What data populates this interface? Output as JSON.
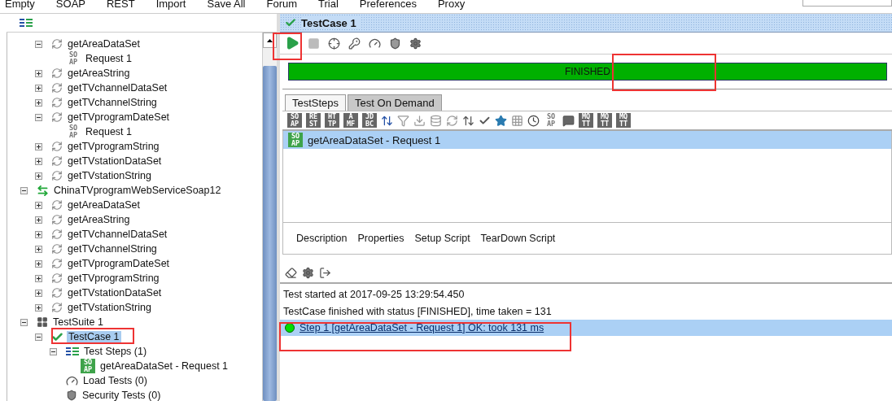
{
  "menu": [
    "Empty",
    "SOAP",
    "REST",
    "Import",
    "Save All",
    "Forum",
    "Trial",
    "Preferences",
    "Proxy"
  ],
  "tree": [
    {
      "kind": "continued",
      "children": [
        {
          "kind": "operation",
          "label": "getAreaDataSet",
          "expanded": true,
          "selected": false,
          "children": [
            {
              "kind": "request",
              "badge": "SO AP",
              "label": "Request 1",
              "selected": false
            }
          ]
        },
        {
          "kind": "operation",
          "label": "getAreaString",
          "expanded": false,
          "selected": false
        },
        {
          "kind": "operation",
          "label": "getTVchannelDataSet",
          "expanded": false,
          "selected": false
        },
        {
          "kind": "operation",
          "label": "getTVchannelString",
          "expanded": false,
          "selected": false
        },
        {
          "kind": "operation",
          "label": "getTVprogramDateSet",
          "expanded": true,
          "selected": false,
          "children": [
            {
              "kind": "request",
              "badge": "SO AP",
              "label": "Request 1",
              "selected": false
            }
          ]
        },
        {
          "kind": "operation",
          "label": "getTVprogramString",
          "expanded": false,
          "selected": false
        },
        {
          "kind": "operation",
          "label": "getTVstationDataSet",
          "expanded": false,
          "selected": false
        },
        {
          "kind": "operation",
          "label": "getTVstationString",
          "expanded": false,
          "selected": false
        }
      ]
    },
    {
      "kind": "service",
      "label": "ChinaTVprogramWebServiceSoap12",
      "expanded": true,
      "selected": false,
      "children": [
        {
          "kind": "operation",
          "label": "getAreaDataSet",
          "expanded": false,
          "selected": false
        },
        {
          "kind": "operation",
          "label": "getAreaString",
          "expanded": false,
          "selected": false
        },
        {
          "kind": "operation",
          "label": "getTVchannelDataSet",
          "expanded": false,
          "selected": false
        },
        {
          "kind": "operation",
          "label": "getTVchannelString",
          "expanded": false,
          "selected": false
        },
        {
          "kind": "operation",
          "label": "getTVprogramDateSet",
          "expanded": false,
          "selected": false
        },
        {
          "kind": "operation",
          "label": "getTVprogramString",
          "expanded": false,
          "selected": false
        },
        {
          "kind": "operation",
          "label": "getTVstationDataSet",
          "expanded": false,
          "selected": false
        },
        {
          "kind": "operation",
          "label": "getTVstationString",
          "expanded": false,
          "selected": false
        }
      ]
    },
    {
      "kind": "suite",
      "label": "TestSuite 1",
      "expanded": true,
      "selected": false,
      "children": [
        {
          "kind": "testcase",
          "label": "TestCase 1",
          "expanded": true,
          "selected": true,
          "children": [
            {
              "kind": "steps",
              "label": "Test Steps (1)",
              "expanded": true,
              "selected": false,
              "children": [
                {
                  "kind": "step",
                  "badge": "SO AP",
                  "label": "getAreaDataSet - Request 1",
                  "selected": false
                }
              ]
            },
            {
              "kind": "load",
              "label": "Load Tests (0)",
              "selected": false
            },
            {
              "kind": "security",
              "label": "Security Tests (0)",
              "selected": false
            }
          ]
        }
      ]
    }
  ],
  "editor": {
    "title": "TestCase 1",
    "progress": {
      "level": 1,
      "label": "FINISHED"
    },
    "tabs": [
      {
        "label": "TestSteps",
        "selected": true
      },
      {
        "label": "Test On Demand",
        "selected": false
      }
    ],
    "step_types_lead": [
      "SO AP",
      "RE ST",
      "HT TP",
      "A MF",
      "JD BC"
    ],
    "step_types_tail": [
      "SO AP",
      "MQ TT",
      "MQ TT",
      "MQ TT"
    ],
    "steps": [
      {
        "badge": "SO AP",
        "label": "getAreaDataSet - Request 1",
        "selected": true
      }
    ],
    "bottom_tabs": [
      "Description",
      "Properties",
      "Setup Script",
      "TearDown Script"
    ],
    "log": [
      "Test started at 2017-09-25 13:29:54.450",
      "TestCase finished with status [FINISHED], time taken = 131"
    ],
    "results": [
      {
        "label": "Step 1 [getAreaDataSet - Request 1] OK: took 131 ms",
        "color": "#00dd00",
        "selected": true
      }
    ]
  }
}
